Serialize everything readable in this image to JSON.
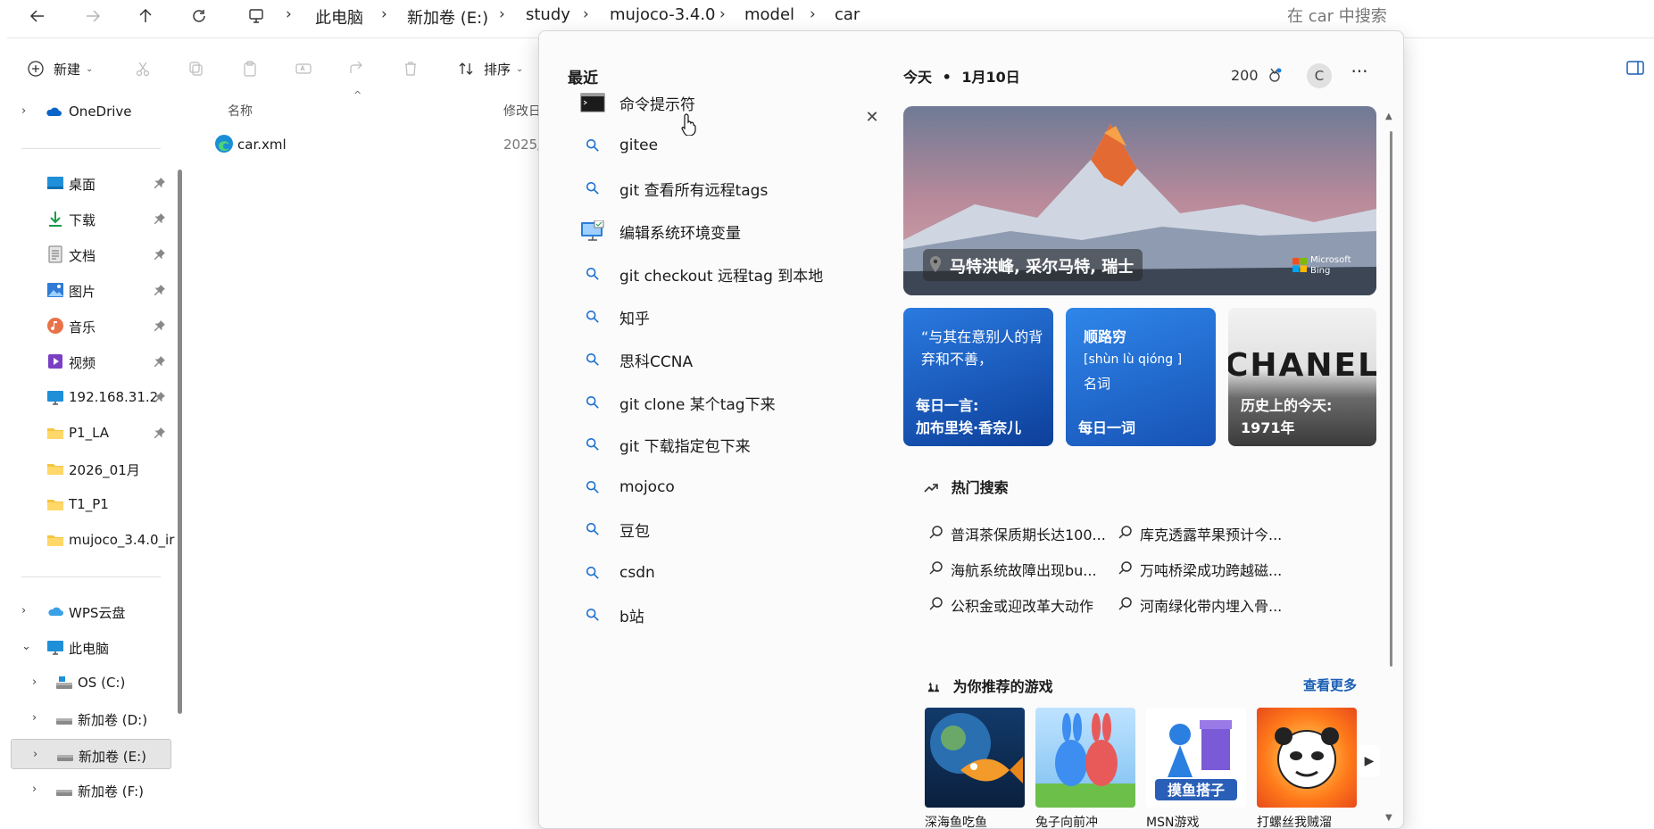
{
  "explorer": {
    "breadcrumb": [
      "此电脑",
      "新加卷 (E:)",
      "study",
      "mujoco-3.4.0",
      "model",
      "car"
    ],
    "search_placeholder": "在 car 中搜索",
    "toolbar": {
      "new_label": "新建",
      "sort_label": "排序"
    },
    "nav": [
      {
        "label": "OneDrive",
        "icon": "onedrive-icon",
        "color": "#0a64c8"
      },
      {
        "label": "桌面",
        "icon": "desktop-icon",
        "pinned": true
      },
      {
        "label": "下载",
        "icon": "download-icon",
        "pinned": true
      },
      {
        "label": "文档",
        "icon": "documents-icon",
        "pinned": true
      },
      {
        "label": "图片",
        "icon": "pictures-icon",
        "pinned": true
      },
      {
        "label": "音乐",
        "icon": "music-icon",
        "pinned": true
      },
      {
        "label": "视频",
        "icon": "videos-icon",
        "pinned": true
      },
      {
        "label": "192.168.31.2",
        "icon": "network-icon",
        "pinned": true
      },
      {
        "label": "P1_LA",
        "icon": "folder-icon",
        "pinned": true
      },
      {
        "label": "2026_01月",
        "icon": "folder-icon"
      },
      {
        "label": "T1_P1",
        "icon": "folder-icon"
      },
      {
        "label": "mujoco_3.4.0_ir",
        "icon": "folder-icon"
      },
      {
        "label": "WPS云盘",
        "icon": "cloud-icon"
      },
      {
        "label": "此电脑",
        "icon": "pc-icon"
      },
      {
        "label": "OS (C:)",
        "icon": "drive-icon"
      },
      {
        "label": "新加卷 (D:)",
        "icon": "drive-icon"
      },
      {
        "label": "新加卷 (E:)",
        "icon": "drive-icon",
        "selected": true
      },
      {
        "label": "新加卷 (F:)",
        "icon": "drive-icon"
      }
    ],
    "columns": {
      "name": "名称",
      "modified": "修改日"
    },
    "files": [
      {
        "name": "car.xml",
        "modified": "2025/"
      }
    ]
  },
  "search_flyout": {
    "recent_title": "最近",
    "recent": [
      {
        "label": "命令提示符",
        "icon": "cmd-icon"
      },
      {
        "label": "gitee",
        "icon": "search-icon"
      },
      {
        "label": "git 查看所有远程tags",
        "icon": "search-icon"
      },
      {
        "label": "编辑系统环境变量",
        "icon": "settings-monitor-icon"
      },
      {
        "label": "git checkout 远程tag 到本地",
        "icon": "search-icon"
      },
      {
        "label": "知乎",
        "icon": "search-icon"
      },
      {
        "label": "思科CCNA",
        "icon": "search-icon"
      },
      {
        "label": "git clone 某个tag下来",
        "icon": "search-icon"
      },
      {
        "label": "git 下载指定包下来",
        "icon": "search-icon"
      },
      {
        "label": "mojoco",
        "icon": "search-icon"
      },
      {
        "label": "豆包",
        "icon": "search-icon"
      },
      {
        "label": "csdn",
        "icon": "search-icon"
      },
      {
        "label": "b站",
        "icon": "search-icon"
      }
    ],
    "today": {
      "title": "今天",
      "date": "1月10日",
      "points": "200",
      "avatar_letter": "C"
    },
    "hero": {
      "location": "马特洪峰, 采尔马特, 瑞士",
      "brand": [
        "Microsoft",
        "Bing"
      ]
    },
    "tiles": [
      {
        "top": "“与其在意别人的背弃和不善，",
        "bottom": [
          "每日一言:",
          "加布里埃·香奈儿"
        ],
        "color": "#1e5fc2"
      },
      {
        "top": "顺路穷",
        "pinyin": "[shùn lù qióng ]",
        "pos": "名词",
        "bottom": [
          "每日一词"
        ],
        "color": "#2a6fd6"
      },
      {
        "top": "CHANEL",
        "bottom": [
          "历史上的今天:",
          "1971年"
        ],
        "color": "#3b3b3b"
      }
    ],
    "hot": {
      "title": "热门搜索",
      "items": [
        "普洱茶保质期长达100...",
        "库克透露苹果预计今...",
        "海航系统故障出现bu...",
        "万吨桥梁成功跨越磁...",
        "公积金或迎改革大动作",
        "河南绿化带内埋入骨..."
      ]
    },
    "games": {
      "title": "为你推荐的游戏",
      "more": "查看更多",
      "items": [
        {
          "label": "深海鱼吃鱼"
        },
        {
          "label": "兔子向前冲"
        },
        {
          "label": "MSN游戏"
        },
        {
          "label": "打螺丝我贼溜"
        }
      ]
    }
  }
}
